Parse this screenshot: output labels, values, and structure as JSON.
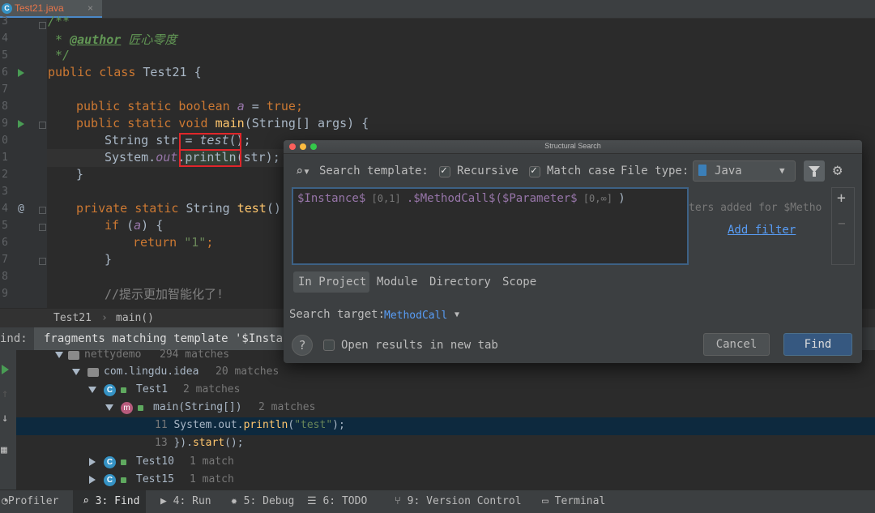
{
  "tab": {
    "icon": "C",
    "name": "Test21.java",
    "close": "×"
  },
  "gutter": {
    "lines": [
      "3",
      "4",
      "5",
      "6",
      "7",
      "8",
      "9",
      "0",
      "1",
      "2",
      "3",
      "4",
      "5",
      "6",
      "7",
      "8",
      "9"
    ],
    "at_marker": "@"
  },
  "code": {
    "l1": "/**",
    "l2_star": " * ",
    "l2_tag": "@author",
    "l2_name": " 匠心零度",
    "l3": " */",
    "l4_kw": "public class",
    "l4_rest": " Test21 {",
    "l6_kw": "public static boolean ",
    "l6_fld": "a",
    "l6_eq": " = ",
    "l6_val": "true",
    "l6_semi": ";",
    "l7_kw": "public static void ",
    "l7_fn": "main",
    "l7_rest": "(String[] args) {",
    "l8_a": "String str ",
    "l8_b": "= ",
    "l8_c": "test",
    "l8_d": "();",
    "l9_a": "System.",
    "l9_b": "out",
    "l9_c": ".",
    "l9_d": "println",
    "l9_e": "(str);",
    "l10": "}",
    "l12_kw": "private static ",
    "l12_type": "String ",
    "l12_fn": "test",
    "l12_rest": "()",
    "l13_kw": "if",
    "l13_a": " (",
    "l13_b": "a",
    "l13_c": ") {",
    "l14_kw": "return ",
    "l14_str": "\"1\"",
    "l14_semi": ";",
    "l15": "}",
    "l17": "//提示更加智能化了!"
  },
  "breadcrumb": {
    "file": "Test21",
    "sep": "›",
    "method": "main()"
  },
  "find_bar": {
    "label": "ind:",
    "tab": "fragments matching template '$Instanc"
  },
  "tree": {
    "root": {
      "name": "nettydemo",
      "count": "294 matches"
    },
    "pkg": {
      "name": "com.lingdu.idea",
      "count": "20 matches"
    },
    "test1": {
      "icon": "C",
      "name": "Test1",
      "count": "2 matches"
    },
    "main": {
      "icon": "m",
      "name": "main(String[])",
      "count": "2 matches"
    },
    "row11_num": "11",
    "row11_a": "System.out.",
    "row11_b": "println",
    "row11_c": "(",
    "row11_d": "\"test\"",
    "row11_e": ");",
    "row13_num": "13",
    "row13_a": "}).",
    "row13_b": "start",
    "row13_c": "();",
    "test10": {
      "icon": "C",
      "name": "Test10",
      "count": "1 match"
    },
    "test15": {
      "icon": "C",
      "name": "Test15",
      "count": "1 match"
    }
  },
  "left_icons": [
    "run-icon",
    "up-icon",
    "down-icon",
    "grid-icon"
  ],
  "toolbar": {
    "profiler": "Profiler",
    "find": "3: Find",
    "run": "4: Run",
    "debug": "5: Debug",
    "todo": "6: TODO",
    "vcs": "9: Version Control",
    "terminal": "Terminal"
  },
  "dialog": {
    "title": "Structural Search",
    "search_template": "Search template:",
    "recursive": "Recursive",
    "match_case": "Match case",
    "file_type_label": "File type:",
    "file_type": "Java",
    "tpl_a": "$Instance$",
    "tpl_b": " [0,1] ",
    "tpl_c": ".$MethodCall$(",
    "tpl_d": "$Parameter$",
    "tpl_e": " [0,∞] ",
    "tpl_f": ")",
    "filters_note": "ters added for $Metho",
    "add_filter": "Add filter",
    "plus": "+",
    "minus": "−",
    "scopes": [
      "In Project",
      "Module",
      "Directory",
      "Scope"
    ],
    "search_target_label": "Search target:",
    "search_target": "MethodCall",
    "help": "?",
    "open_new_tab": "Open results in new tab",
    "cancel": "Cancel",
    "find": "Find"
  }
}
